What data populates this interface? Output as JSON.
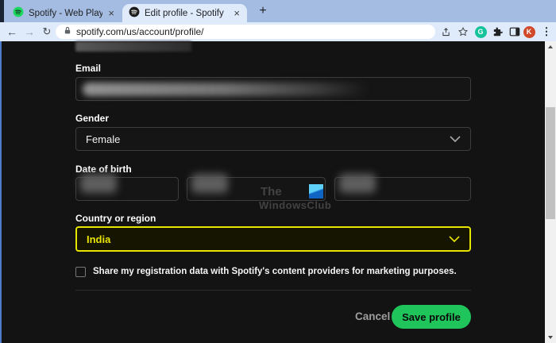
{
  "browser": {
    "tabs": [
      {
        "title": "Spotify - Web Player: Music for e"
      },
      {
        "title": "Edit profile - Spotify"
      }
    ],
    "close_icon": "×",
    "new_tab_icon": "+",
    "back_icon": "←",
    "forward_icon": "→",
    "reload_icon": "↻",
    "menu_icon": "⋮",
    "url": "spotify.com/us/account/profile/",
    "grammarly_letter": "G",
    "avatar_letter": "K"
  },
  "profile_form": {
    "email_label": "Email",
    "gender_label": "Gender",
    "gender_value": "Female",
    "dob_label": "Date of birth",
    "country_label": "Country or region",
    "country_value": "India",
    "marketing_checkbox_label": "Share my registration data with Spotify's content providers for marketing purposes.",
    "checkbox_checked": false,
    "cancel_label": "Cancel",
    "save_label": "Save profile"
  },
  "watermark": {
    "line1": "The",
    "line2": "WindowsClub"
  },
  "colors": {
    "spotify_green": "#1ed760",
    "save_button": "#1fc55b",
    "country_highlight": "#e8e500",
    "page_background": "#131313",
    "tab_strip": "#a4bce1",
    "toolbar": "#dfeafb",
    "avatar": "#d2492a",
    "grammarly": "#15c39a"
  }
}
